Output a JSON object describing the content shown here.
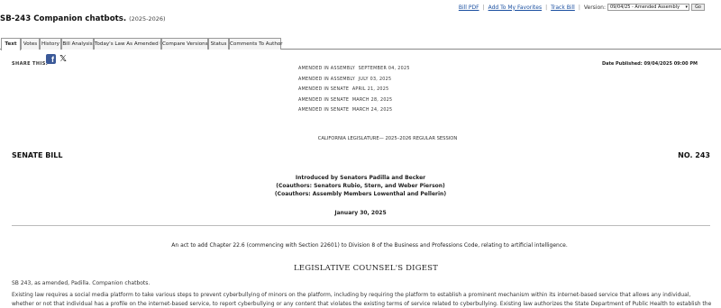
{
  "header": {
    "bill_title": "SB-243 Companion chatbots.",
    "session": "(2025-2026)"
  },
  "actions": {
    "bill_pdf": "Bill PDF",
    "sep": "|",
    "favorites": "Add To My Favorites",
    "track": "Track Bill",
    "version_label": "Version:",
    "version_value": "09/04/25 - Amended Assembly",
    "go": "Go"
  },
  "tabs": [
    {
      "label": "Text",
      "active": true
    },
    {
      "label": "Votes"
    },
    {
      "label": "History"
    },
    {
      "label": "Bill Analysis"
    },
    {
      "label": "Today's Law As Amended ⓘ"
    },
    {
      "label": "Compare Versions"
    },
    {
      "label": "Status"
    },
    {
      "label": "Comments To Author"
    }
  ],
  "share": {
    "label": "SHARE THIS:",
    "facebook_icon": "f",
    "x_icon": "𝕏"
  },
  "date_published": "Date Published: 09/04/2025 09:00 PM",
  "amendments": [
    {
      "house": "AMENDED  IN  ASSEMBLY",
      "date": "SEPTEMBER 04, 2025"
    },
    {
      "house": "AMENDED  IN  ASSEMBLY",
      "date": "JULY 03, 2025"
    },
    {
      "house": "AMENDED  IN  SENATE",
      "date": "APRIL 21, 2025"
    },
    {
      "house": "AMENDED  IN  SENATE",
      "date": "MARCH 28, 2025"
    },
    {
      "house": "AMENDED  IN  SENATE",
      "date": "MARCH 24, 2025"
    }
  ],
  "legislature": "CALIFORNIA LEGISLATURE— 2025–2026 REGULAR SESSION",
  "bill_type": "SENATE BILL",
  "bill_number": "NO. 243",
  "introduced": [
    "Introduced by Senators Padilla and Becker",
    "(Coauthors: Senators Rubio, Stern, and Weber Pierson)",
    "(Coauthors: Assembly Members Lowenthal and Pellerin)"
  ],
  "intro_date": "January 30, 2025",
  "act_text": "An act to add Chapter 22.6 (commencing with Section 22601) to Division 8 of the Business and Professions Code, relating to artificial intelligence.",
  "digest_title": "LEGISLATIVE COUNSEL'S DIGEST",
  "sb_line": "SB 243, as amended, Padilla. Companion chatbots.",
  "digest_paragraph": "Existing law requires a social media platform to take various steps to prevent cyberbullying of minors on the platform, including by requiring the platform to establish a prominent mechanism within its internet-based service that allows any individual, whether or not that individual has a profile on the internet-based service, to report cyberbullying or any content that violates the existing terms of service related to cyberbullying. Existing law authorizes the State Department of Public Health to establish the Office of Suicide Prevention in the department, as prescribed."
}
